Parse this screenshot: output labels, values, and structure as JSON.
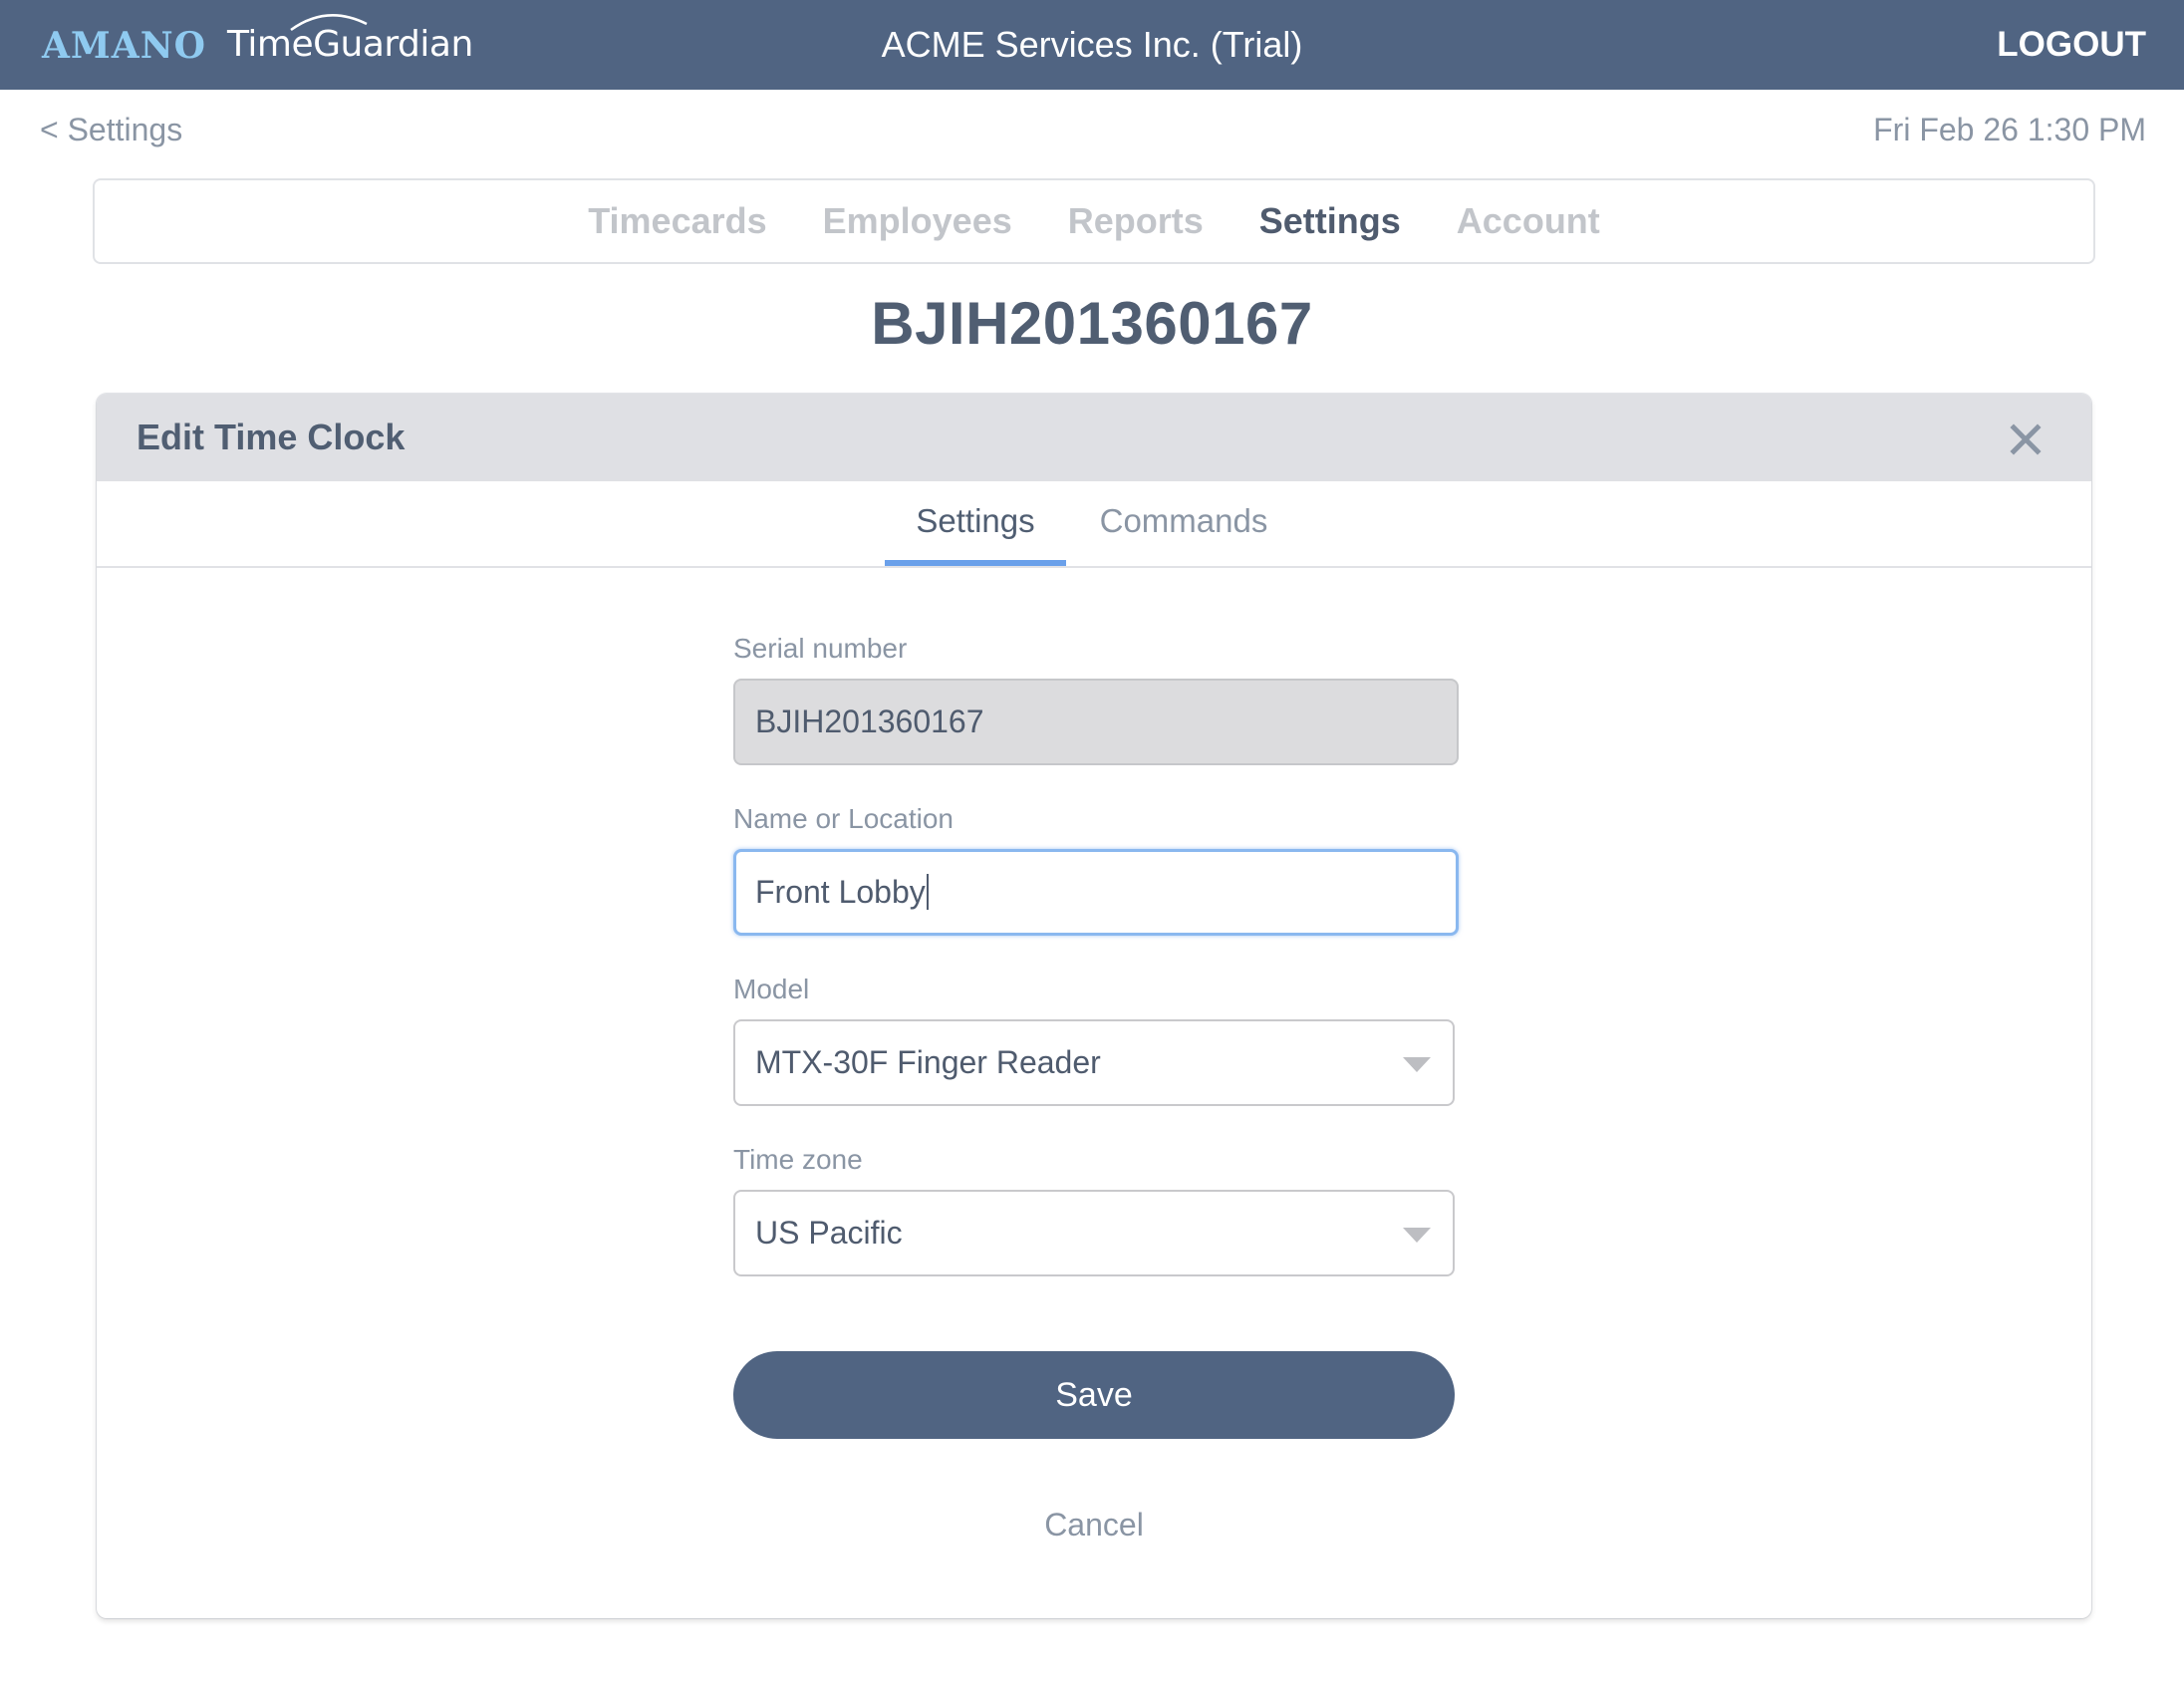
{
  "header": {
    "logo_brand": "AMANO",
    "logo_product": "TimeGuardian",
    "company": "ACME Services Inc. (Trial)",
    "logout_label": "LOGOUT"
  },
  "subheader": {
    "back_label": "< Settings",
    "datetime": "Fri Feb 26 1:30 PM"
  },
  "nav": {
    "items": [
      {
        "label": "Timecards",
        "active": false
      },
      {
        "label": "Employees",
        "active": false
      },
      {
        "label": "Reports",
        "active": false
      },
      {
        "label": "Settings",
        "active": true
      },
      {
        "label": "Account",
        "active": false
      }
    ]
  },
  "page_title": "BJIH201360167",
  "modal": {
    "title": "Edit Time Clock",
    "close_icon": "close-icon",
    "tabs": [
      {
        "label": "Settings",
        "active": true
      },
      {
        "label": "Commands",
        "active": false
      }
    ],
    "form": {
      "serial": {
        "label": "Serial number",
        "value": "BJIH201360167",
        "readonly": true
      },
      "name": {
        "label": "Name or Location",
        "value": "Front Lobby",
        "focused": true
      },
      "model": {
        "label": "Model",
        "value": "MTX-30F Finger Reader"
      },
      "timezone": {
        "label": "Time zone",
        "value": "US Pacific"
      }
    },
    "save_label": "Save",
    "cancel_label": "Cancel"
  },
  "colors": {
    "header_bg": "#506482",
    "logo_brand": "#8fcaf0",
    "accent_tab": "#6aa0ea",
    "focus_border": "#8ab8ef",
    "primary_button": "#506482",
    "text_dark": "#505e72",
    "text_muted": "#8a95a4"
  }
}
